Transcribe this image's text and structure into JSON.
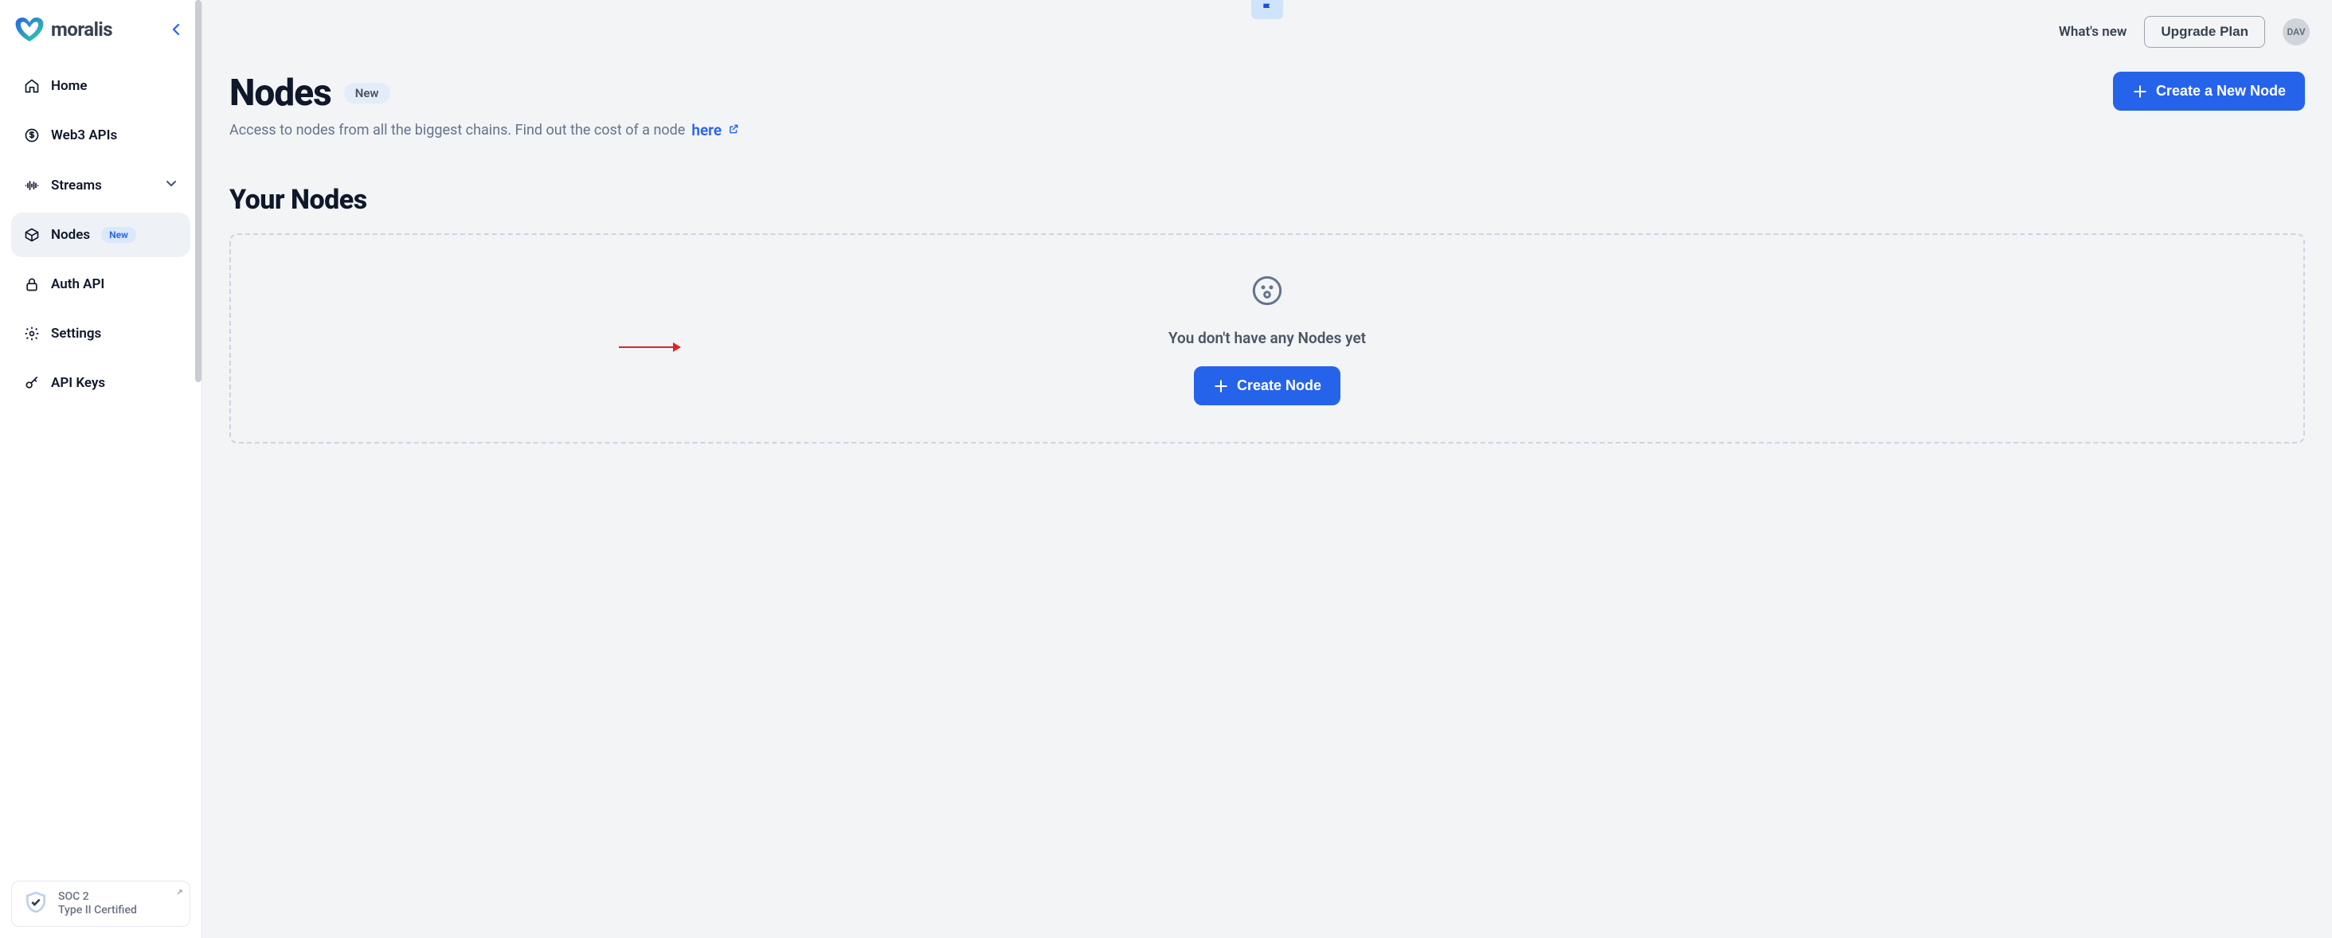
{
  "brand": {
    "name": "moralis"
  },
  "header": {
    "whats_new": "What's new",
    "upgrade": "Upgrade Plan",
    "avatar_initials": "DAV"
  },
  "sidebar": {
    "items": [
      {
        "label": "Home"
      },
      {
        "label": "Web3 APIs"
      },
      {
        "label": "Streams"
      },
      {
        "label": "Nodes",
        "badge": "New"
      },
      {
        "label": "Auth API"
      },
      {
        "label": "Settings"
      },
      {
        "label": "API Keys"
      }
    ],
    "soc": {
      "line1": "SOC 2",
      "line2": "Type II Certified"
    }
  },
  "page": {
    "title": "Nodes",
    "badge": "New",
    "subtitle_text": "Access to nodes from all the biggest chains. Find out the cost of a node",
    "subtitle_link": "here",
    "create_top": "Create a New Node",
    "section_title": "Your Nodes",
    "empty_text": "You don't have any Nodes yet",
    "create_center": "Create Node"
  }
}
